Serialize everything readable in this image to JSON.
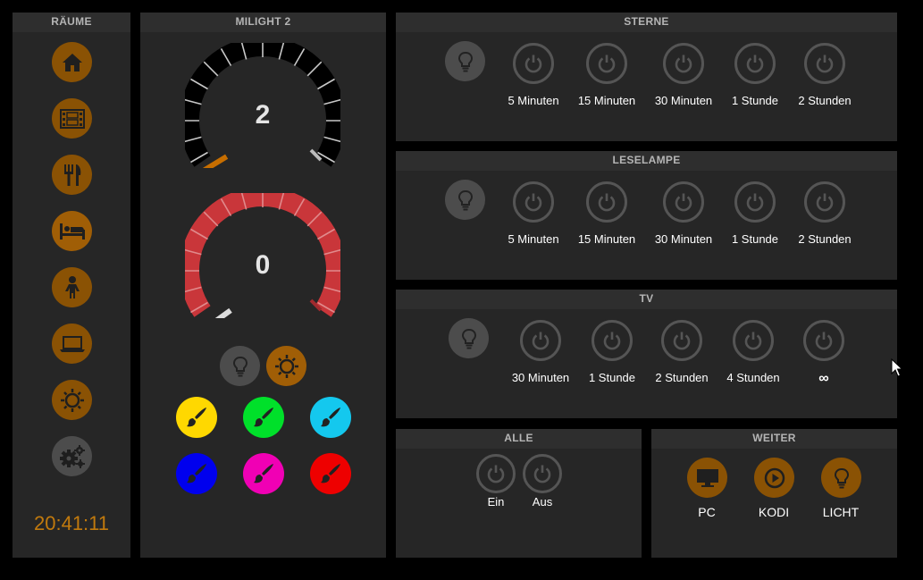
{
  "rooms": {
    "title": "RÄUME",
    "items": [
      {
        "icon": "home-icon"
      },
      {
        "icon": "film-icon"
      },
      {
        "icon": "dining-icon"
      },
      {
        "icon": "bed-icon"
      },
      {
        "icon": "child-icon"
      },
      {
        "icon": "laptop-icon"
      },
      {
        "icon": "sun-icon"
      },
      {
        "icon": "settings-icon"
      }
    ],
    "clock": "20:41:11"
  },
  "milight": {
    "title": "MILIGHT 2",
    "brightness_value": "2",
    "color_value": "0",
    "brightness_fraction": 0.02,
    "color_fraction": 0.0,
    "colors": [
      "#ffd800",
      "#00e02a",
      "#14c8ee",
      "#0000ee",
      "#f000b4",
      "#ee0000"
    ]
  },
  "sterne": {
    "title": "STERNE",
    "timers": [
      "5 Minuten",
      "15 Minuten",
      "30 Minuten",
      "1 Stunde",
      "2 Stunden"
    ]
  },
  "leselampe": {
    "title": "LESELAMPE",
    "timers": [
      "5 Minuten",
      "15 Minuten",
      "30 Minuten",
      "1 Stunde",
      "2 Stunden"
    ]
  },
  "tv": {
    "title": "TV",
    "timers": [
      "30 Minuten",
      "1 Stunde",
      "2 Stunden",
      "4 Stunden",
      "∞"
    ]
  },
  "alle": {
    "title": "ALLE",
    "on_label": "Ein",
    "off_label": "Aus"
  },
  "weiter": {
    "title": "WEITER",
    "items": [
      "PC",
      "KODI",
      "LICHT"
    ]
  }
}
